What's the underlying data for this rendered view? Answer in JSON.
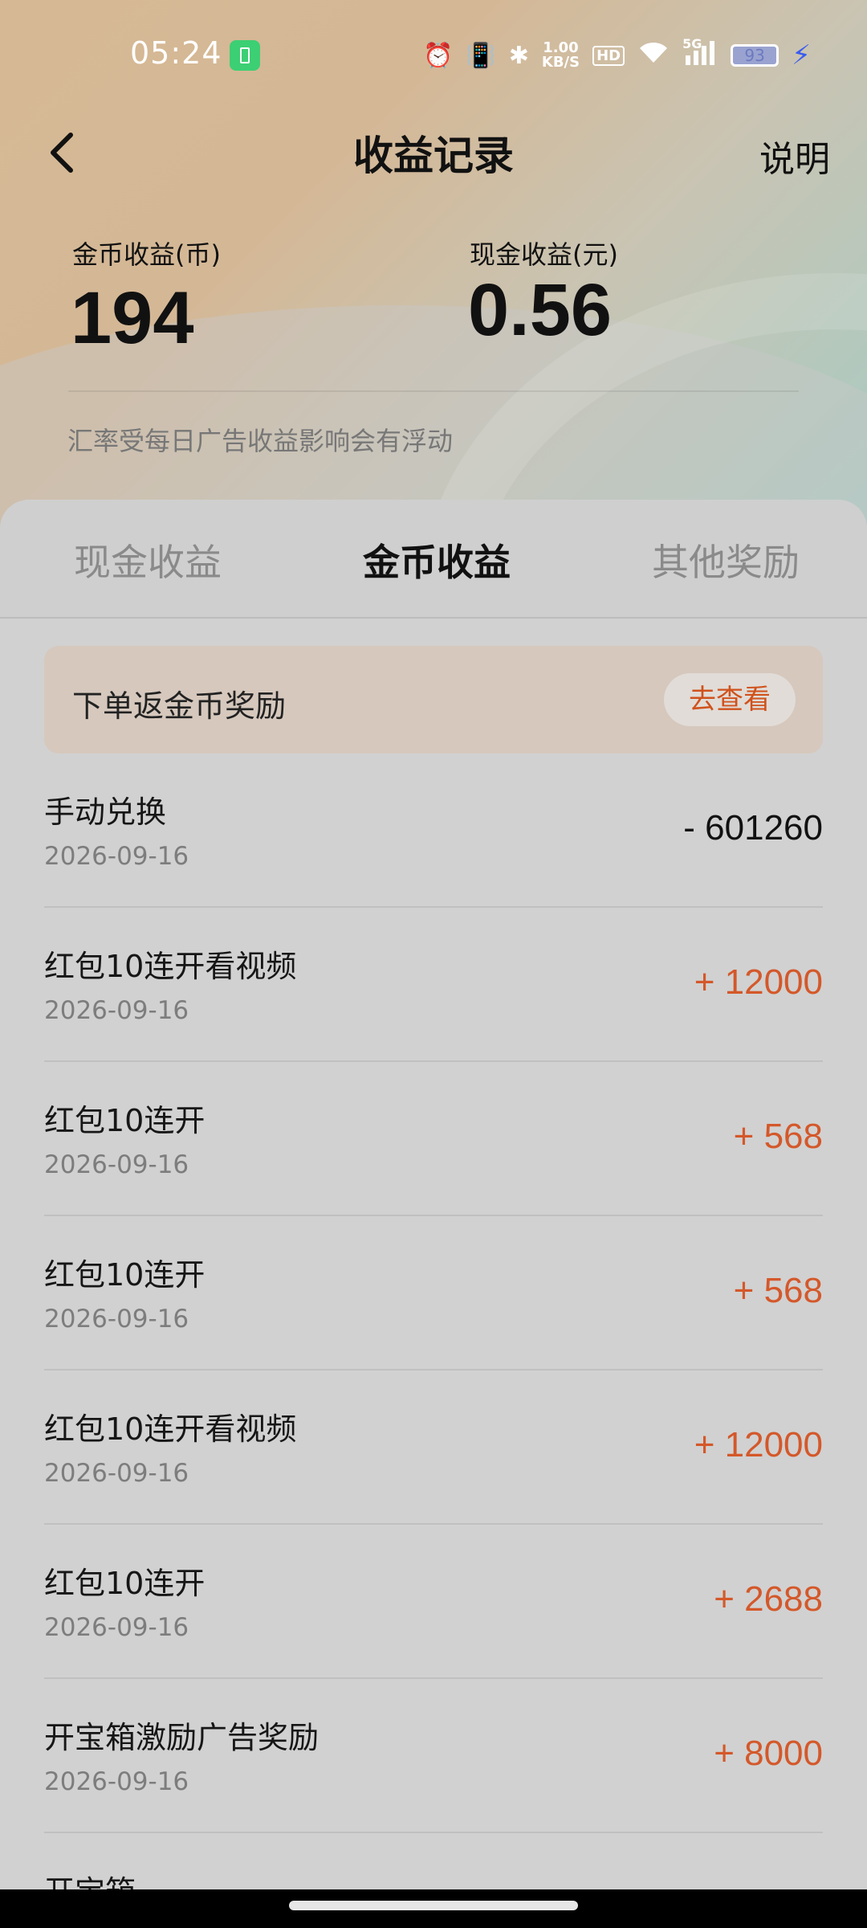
{
  "status_bar": {
    "time": "05:24",
    "speed_value": "1.00",
    "speed_unit": "KB/S",
    "hd_label": "HD",
    "network_label": "5G",
    "battery_level": "93"
  },
  "header": {
    "title": "收益记录",
    "right_link": "说明"
  },
  "summary": {
    "coin_label": "金币收益(币)",
    "coin_value": "194",
    "cash_label": "现金收益(元)",
    "cash_value": "0.56",
    "note": "汇率受每日广告收益影响会有浮动"
  },
  "tabs": [
    {
      "label": "现金收益",
      "active": false
    },
    {
      "label": "金币收益",
      "active": true
    },
    {
      "label": "其他奖励",
      "active": false
    }
  ],
  "promo": {
    "text": "下单返金币奖励",
    "button": "去查看"
  },
  "records": [
    {
      "title": "手动兑换",
      "date": "2026-09-16",
      "amount": "- 601260",
      "type": "neg"
    },
    {
      "title": "红包10连开看视频",
      "date": "2026-09-16",
      "amount": "+ 12000",
      "type": "pos"
    },
    {
      "title": "红包10连开",
      "date": "2026-09-16",
      "amount": "+ 568",
      "type": "pos"
    },
    {
      "title": "红包10连开",
      "date": "2026-09-16",
      "amount": "+ 568",
      "type": "pos"
    },
    {
      "title": "红包10连开看视频",
      "date": "2026-09-16",
      "amount": "+ 12000",
      "type": "pos"
    },
    {
      "title": "红包10连开",
      "date": "2026-09-16",
      "amount": "+ 2688",
      "type": "pos"
    },
    {
      "title": "开宝箱激励广告奖励",
      "date": "2026-09-16",
      "amount": "+ 8000",
      "type": "pos"
    },
    {
      "title": "开宝箱",
      "date": "",
      "amount": "",
      "type": "pos"
    }
  ],
  "colors": {
    "accent_positive": "#d4582a",
    "negative": "#111111",
    "promo_bg": "#d6c8bd"
  }
}
